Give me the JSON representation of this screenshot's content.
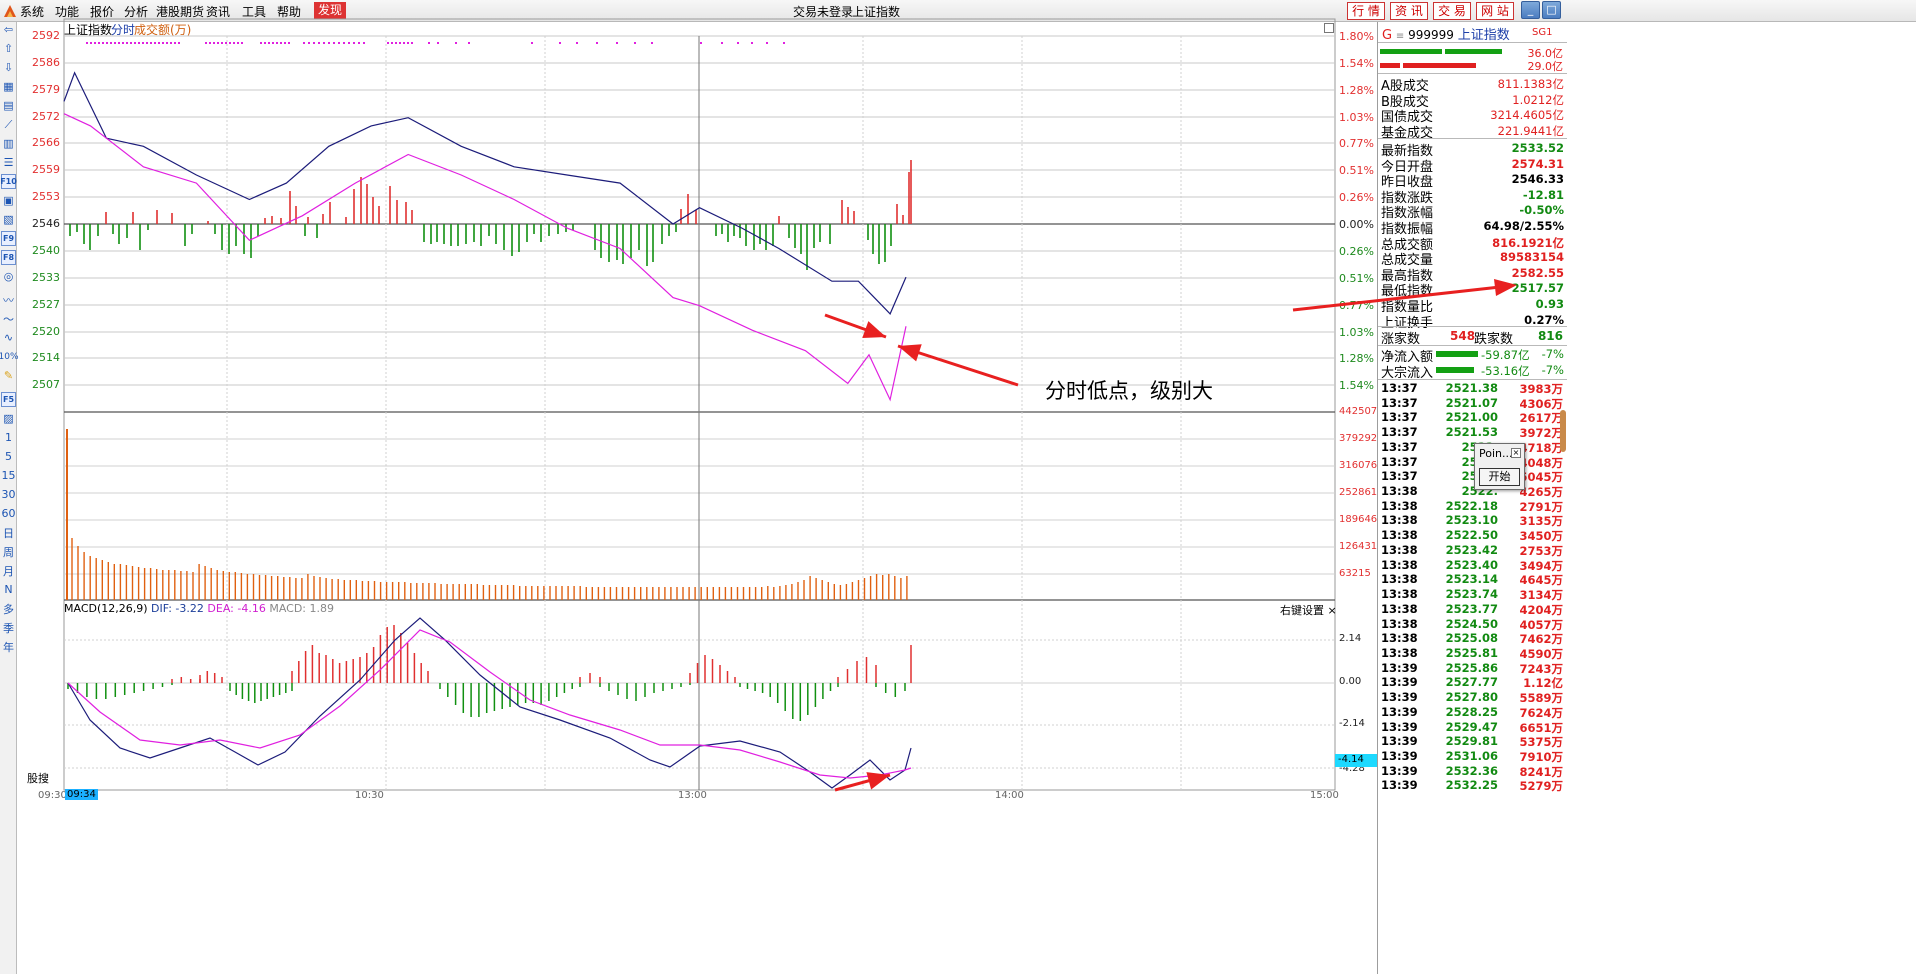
{
  "menu": {
    "items": [
      "系统",
      "功能",
      "报价",
      "分析",
      "港股期货",
      "资讯",
      "工具",
      "帮助"
    ],
    "active": "发现",
    "login_status": "交易未登录",
    "window_title": "上证指数",
    "right_buttons": [
      "行 情",
      "资 讯",
      "交 易",
      "网 站"
    ]
  },
  "left_toolbar": {
    "icon_names": [
      "back-arrow-icon",
      "up-arrow-icon",
      "down-arrow-icon",
      "grid-icon",
      "table-icon",
      "line-chart-icon",
      "candle-icon",
      "list-icon",
      "news-icon",
      "f10-icon",
      "calendar-icon",
      "lock-icon",
      "refresh-icon",
      "circle-icon",
      "wave-icon",
      "wave2-icon",
      "wave3-icon",
      "pencil-icon"
    ],
    "boxed_labels": [
      "F10",
      "F9",
      "F8"
    ],
    "percent_label": "10%",
    "bottom_box": "F5",
    "periods": [
      "1",
      "5",
      "15",
      "30",
      "60",
      "日",
      "周",
      "月",
      "N",
      "多",
      "季",
      "年"
    ]
  },
  "chart": {
    "header": {
      "name": "上证指数",
      "mode": "分时",
      "vol_label": "成交额(万)"
    },
    "left_axis": [
      "2592",
      "2586",
      "2579",
      "2572",
      "2566",
      "2559",
      "2553",
      "2546",
      "2540",
      "2533",
      "2527",
      "2520",
      "2514",
      "2507"
    ],
    "right_axis": [
      "1.80%",
      "1.54%",
      "1.28%",
      "1.03%",
      "0.77%",
      "0.51%",
      "0.26%",
      "0.00%",
      "0.26%",
      "0.51%",
      "0.77%",
      "1.03%",
      "1.28%",
      "1.54%"
    ],
    "volume_axis": [
      "442507",
      "379292",
      "316076",
      "252861",
      "189646",
      "126431",
      "63215"
    ],
    "macd_head": {
      "name": "MACD(12,26,9)",
      "dif": "DIF: -3.22",
      "dea": "DEA: -4.16",
      "macd": "MACD: 1.89"
    },
    "right_settings": "右键设置",
    "macd_axis": [
      "2.14",
      "0.00",
      "-2.14",
      "-4.28"
    ],
    "macd_value_badge": "-4.14",
    "time_axis": [
      "09:30",
      "10:30",
      "13:00",
      "14:00",
      "15:00"
    ],
    "current_time": "09:34",
    "search_label": "股搜",
    "annotation_text": "分时低点，级别大",
    "colors": {
      "price_line": "#1c1c7a",
      "avg_line": "#e020e0",
      "up": "#e03030",
      "down": "#109010"
    }
  },
  "chart_data": {
    "type": "line",
    "title": "上证指数",
    "x_range": [
      "09:30",
      "15:00"
    ],
    "ylim": [
      2500,
      2592
    ],
    "prev_close": 2546.33,
    "series": [
      {
        "name": "price",
        "x": [
          "09:30",
          "09:32",
          "09:38",
          "09:45",
          "09:55",
          "10:05",
          "10:12",
          "10:20",
          "10:28",
          "10:35",
          "10:45",
          "10:55",
          "11:05",
          "11:15",
          "11:25",
          "13:00",
          "13:08",
          "13:15",
          "13:25",
          "13:30",
          "13:33",
          "13:36",
          "13:39"
        ],
        "values": [
          2576,
          2583,
          2567,
          2565,
          2558,
          2552,
          2556,
          2565,
          2570,
          2572,
          2565,
          2560,
          2558,
          2556,
          2546,
          2550,
          2545,
          2540,
          2532,
          2532,
          2528,
          2524,
          2533
        ]
      },
      {
        "name": "avg",
        "x": [
          "09:30",
          "09:35",
          "09:45",
          "09:55",
          "10:05",
          "10:15",
          "10:25",
          "10:35",
          "10:45",
          "10:55",
          "11:05",
          "11:15",
          "11:25",
          "13:00",
          "13:10",
          "13:20",
          "13:28",
          "13:32",
          "13:36",
          "13:39"
        ],
        "values": [
          2573,
          2570,
          2560,
          2556,
          2542,
          2548,
          2556,
          2563,
          2558,
          2552,
          2545,
          2540,
          2528,
          2526,
          2520,
          2515,
          2507,
          2514,
          2503,
          2521
        ]
      }
    ]
  },
  "quote": {
    "code_prefix": "G",
    "code": "999999",
    "name": "上证指数",
    "tag": "SG1",
    "bar_values": [
      "36.0亿",
      "29.0亿"
    ],
    "rows": [
      {
        "label": "A股成交",
        "value": "811.1383亿",
        "color": "red"
      },
      {
        "label": "B股成交",
        "value": "1.0212亿",
        "color": "red"
      },
      {
        "label": "国债成交",
        "value": "3214.4605亿",
        "color": "red"
      },
      {
        "label": "基金成交",
        "value": "221.9441亿",
        "color": "red"
      },
      {
        "label": "最新指数",
        "value": "2533.52",
        "color": "green"
      },
      {
        "label": "今日开盘",
        "value": "2574.31",
        "color": "red"
      },
      {
        "label": "昨日收盘",
        "value": "2546.33",
        "color": "black"
      },
      {
        "label": "指数涨跌",
        "value": "-12.81",
        "color": "green"
      },
      {
        "label": "指数涨幅",
        "value": "-0.50%",
        "color": "green"
      },
      {
        "label": "指数振幅",
        "value": "64.98/2.55%",
        "color": "black"
      },
      {
        "label": "总成交额",
        "value": "816.1921亿",
        "color": "red"
      },
      {
        "label": "总成交量",
        "value": "89583154",
        "color": "red"
      },
      {
        "label": "最高指数",
        "value": "2582.55",
        "color": "red"
      },
      {
        "label": "最低指数",
        "value": "2517.57",
        "color": "green"
      },
      {
        "label": "指数量比",
        "value": "0.93",
        "color": "green"
      },
      {
        "label": "上证换手",
        "value": "0.27%",
        "color": "black"
      }
    ],
    "up_label": "涨家数",
    "up_count": "548",
    "down_label": "跌家数",
    "down_count": "816",
    "flows": [
      {
        "label": "净流入额",
        "value": "-59.87亿",
        "pct": "-7%"
      },
      {
        "label": "大宗流入",
        "value": "-53.16亿",
        "pct": "-7%"
      }
    ]
  },
  "ticks": [
    [
      "13:37",
      "2521.38",
      "3983万"
    ],
    [
      "13:37",
      "2521.07",
      "4306万"
    ],
    [
      "13:37",
      "2521.00",
      "2617万"
    ],
    [
      "13:37",
      "2521.53",
      "3972万"
    ],
    [
      "13:37",
      "2522.",
      "4718万"
    ],
    [
      "13:37",
      "2521.",
      "4048万"
    ],
    [
      "13:37",
      "2521.",
      "5045万"
    ],
    [
      "13:38",
      "2522.",
      "4265万"
    ],
    [
      "13:38",
      "2522.18",
      "2791万"
    ],
    [
      "13:38",
      "2523.10",
      "3135万"
    ],
    [
      "13:38",
      "2522.50",
      "3450万"
    ],
    [
      "13:38",
      "2523.42",
      "2753万"
    ],
    [
      "13:38",
      "2523.40",
      "3494万"
    ],
    [
      "13:38",
      "2523.14",
      "4645万"
    ],
    [
      "13:38",
      "2523.74",
      "3134万"
    ],
    [
      "13:38",
      "2523.77",
      "4204万"
    ],
    [
      "13:38",
      "2524.50",
      "4057万"
    ],
    [
      "13:38",
      "2525.08",
      "7462万"
    ],
    [
      "13:38",
      "2525.81",
      "4590万"
    ],
    [
      "13:39",
      "2525.86",
      "7243万"
    ],
    [
      "13:39",
      "2527.77",
      "1.12亿"
    ],
    [
      "13:39",
      "2527.80",
      "5589万"
    ],
    [
      "13:39",
      "2528.25",
      "7624万"
    ],
    [
      "13:39",
      "2529.47",
      "6651万"
    ],
    [
      "13:39",
      "2529.81",
      "5375万"
    ],
    [
      "13:39",
      "2531.06",
      "7910万"
    ],
    [
      "13:39",
      "2532.36",
      "8241万"
    ],
    [
      "13:39",
      "2532.25",
      "5279万"
    ]
  ],
  "popup": {
    "title": "Poin...",
    "button": "开始"
  }
}
